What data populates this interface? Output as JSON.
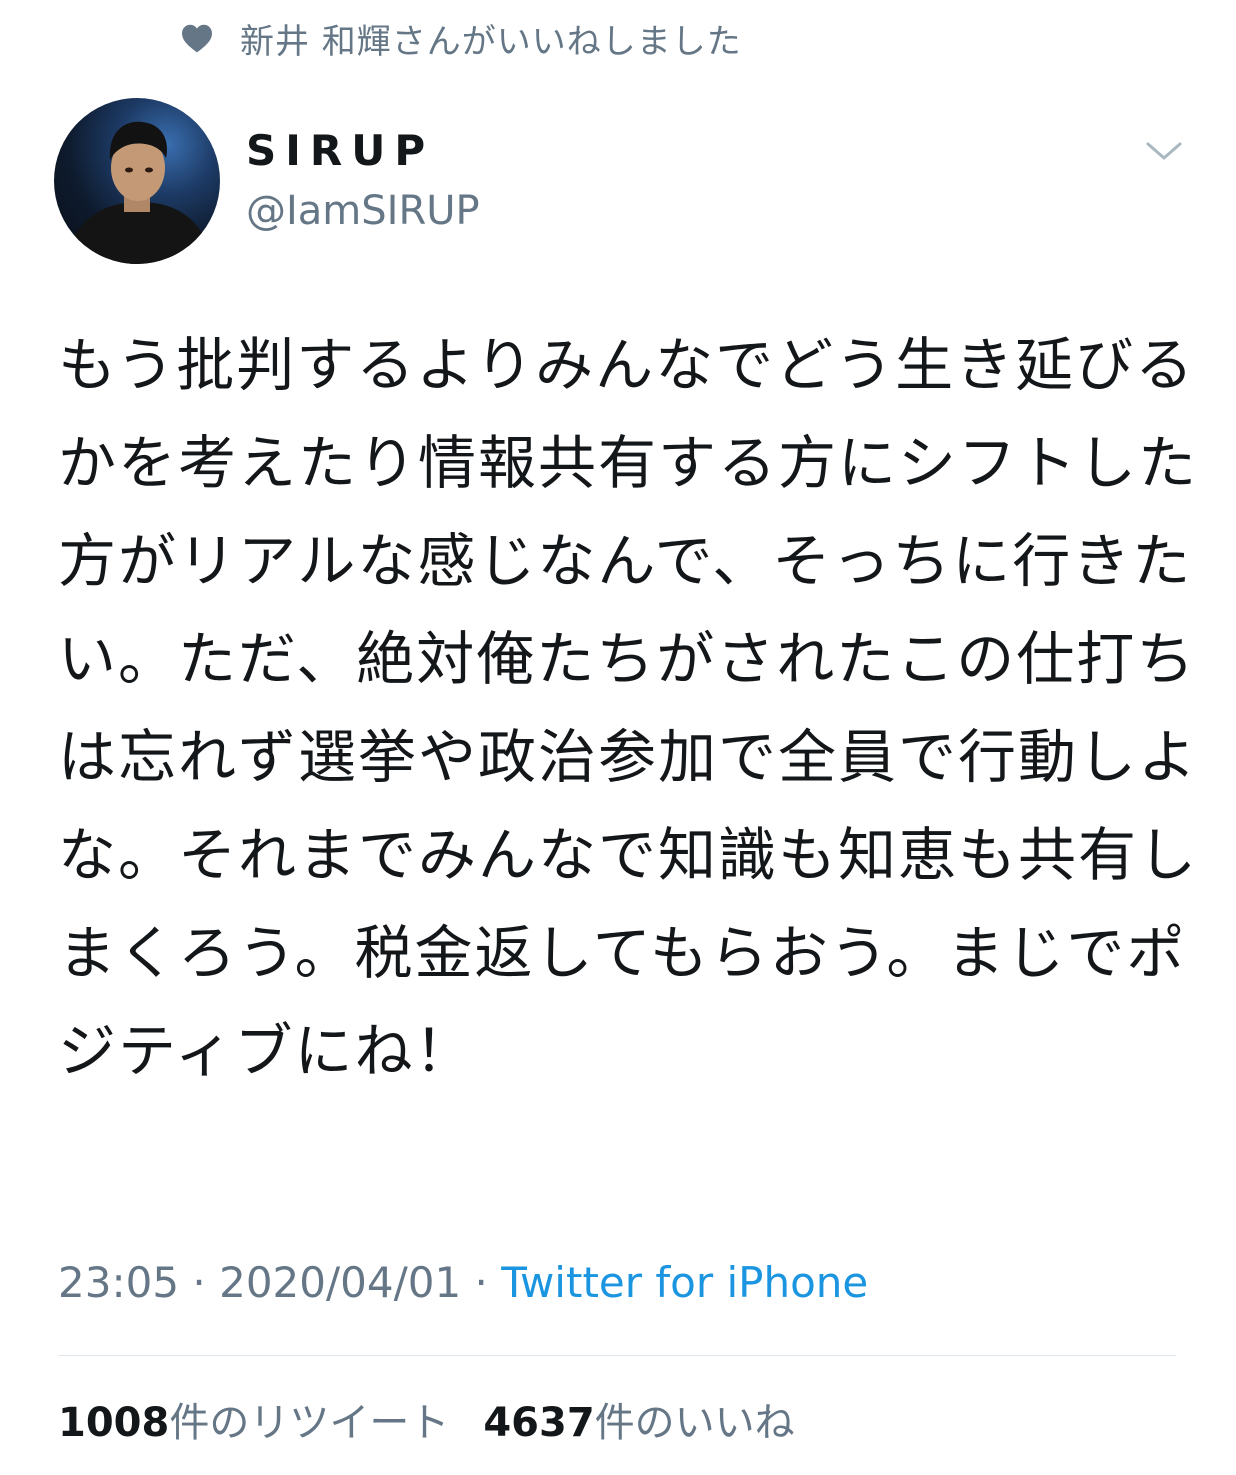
{
  "social_context": {
    "text": "新井 和輝さんがいいねしました",
    "icon": "heart-icon"
  },
  "author": {
    "display_name": "SIRUP",
    "handle": "@IamSIRUP"
  },
  "tweet": {
    "text": "もう批判するよりみんなでどう生き延びるかを考えたり情報共有する方にシフトした方がリアルな感じなんで、そっちに行きたい。ただ、絶対俺たちがされたこの仕打ちは忘れず選挙や政治参加で全員で行動しよな。それまでみんなで知識も知恵も共有しまくろう。税金返してもらおう。まじでポジティブにね！"
  },
  "meta": {
    "time": "23:05",
    "separator": " · ",
    "date": "2020/04/01",
    "source": "Twitter for iPhone"
  },
  "stats": {
    "retweets_count": "1008",
    "retweets_label": "件のリツイート",
    "likes_count": "4637",
    "likes_label": "件のいいね"
  },
  "colors": {
    "secondary_text": "#657786",
    "link": "#1b95e0",
    "primary_text": "#14171a",
    "divider": "#e1e8ed"
  }
}
